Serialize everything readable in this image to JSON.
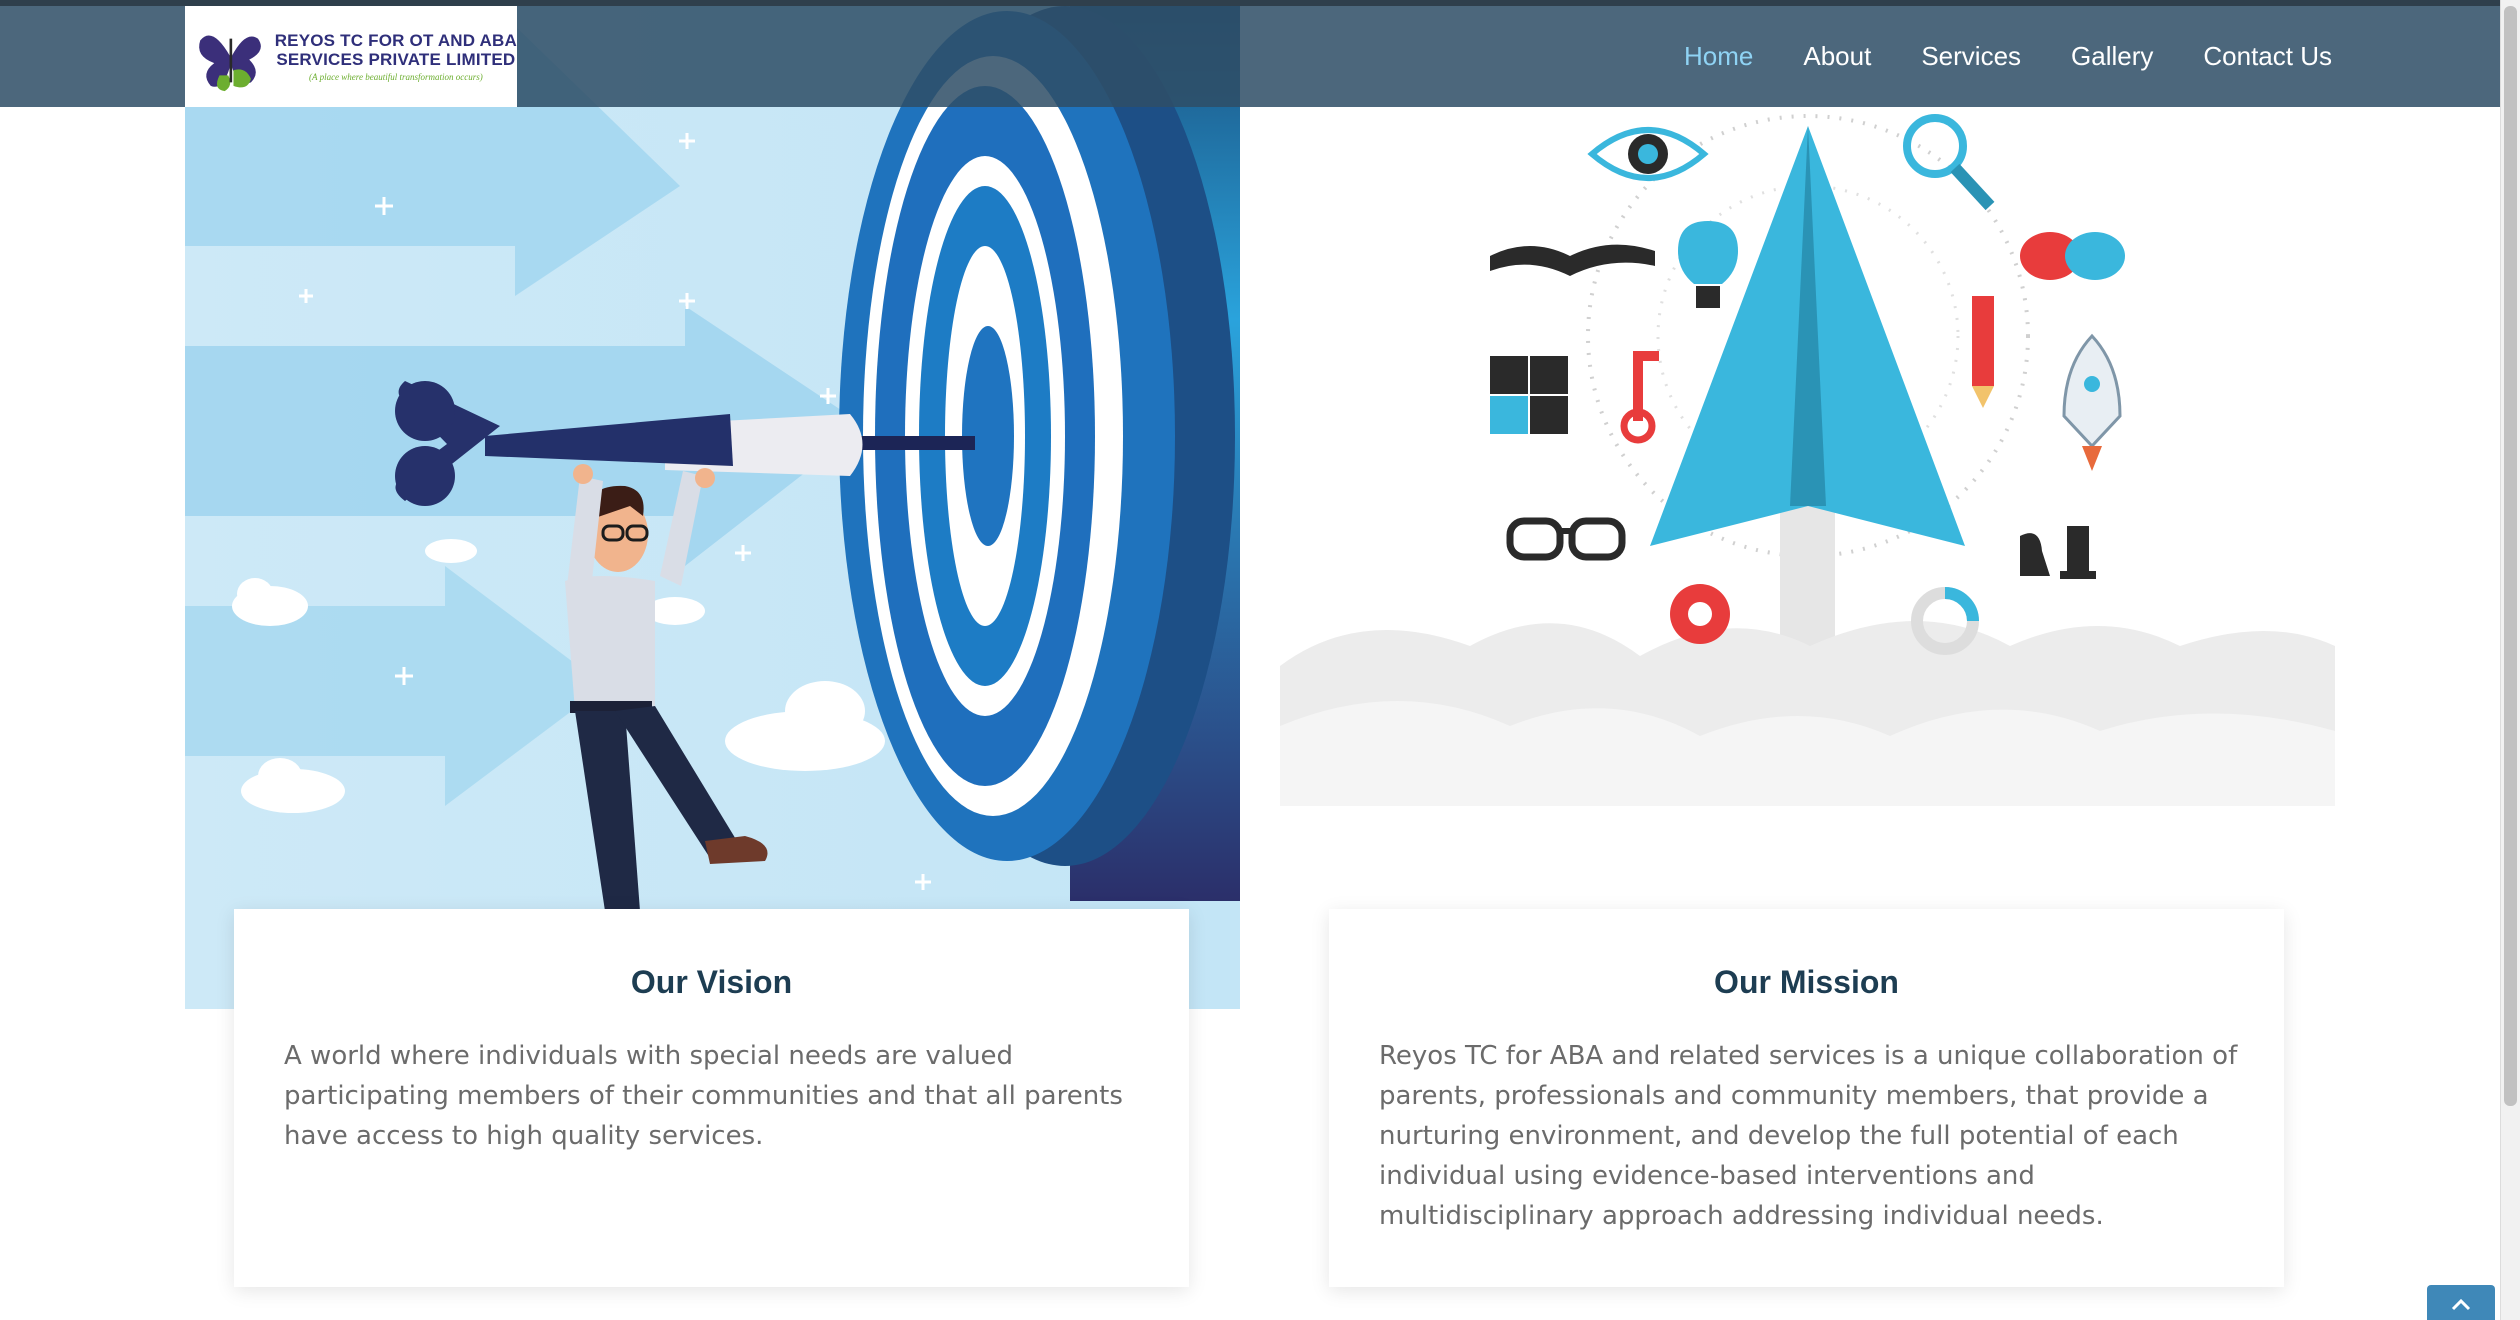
{
  "header": {
    "logo": {
      "line1": "REYOS TC FOR OT AND ABA",
      "line2": "SERVICES PRIVATE LIMITED",
      "tagline": "(A place where beautiful transformation occurs)"
    },
    "nav": [
      {
        "label": "Home",
        "active": true
      },
      {
        "label": "About",
        "active": false
      },
      {
        "label": "Services",
        "active": false
      },
      {
        "label": "Gallery",
        "active": false
      },
      {
        "label": "Contact Us",
        "active": false
      }
    ]
  },
  "vision": {
    "title": "Our Vision",
    "text": "A world where individuals with special needs are valued participating members of their communities and that all parents have access to high quality services."
  },
  "mission": {
    "title": "Our Mission",
    "text": "Reyos TC for ABA and related services is a unique collaboration of parents, professionals and community members, that provide a nurturing environment, and develop the full potential of each individual using evidence-based interventions and multidisciplinary approach addressing individual needs."
  },
  "icons": {
    "scroll_top": "chevron-up-icon"
  },
  "colors": {
    "header_bg": "#2f4e66",
    "nav_active": "#8fd3f4",
    "title": "#1d3d52",
    "body_text": "#6b6b6b",
    "accent_blue": "#3ab4dc",
    "scroll_top_bg": "#3f88b8"
  }
}
